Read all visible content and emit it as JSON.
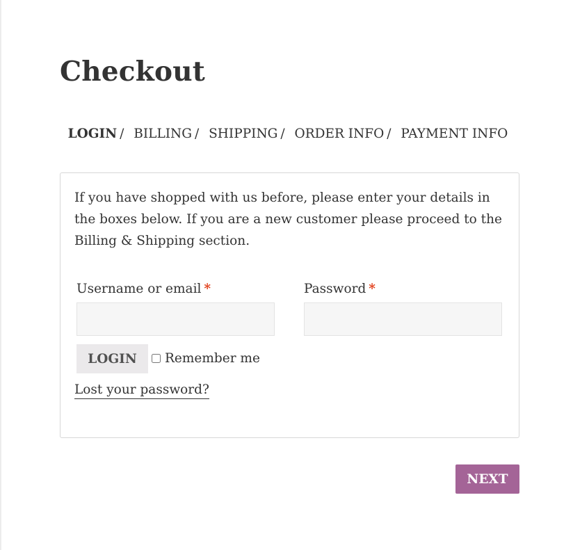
{
  "page": {
    "title": "Checkout"
  },
  "steps": [
    {
      "label": "LOGIN",
      "active": true
    },
    {
      "label": "BILLING",
      "active": false
    },
    {
      "label": "SHIPPING",
      "active": false
    },
    {
      "label": "ORDER INFO",
      "active": false
    },
    {
      "label": "PAYMENT INFO",
      "active": false
    }
  ],
  "step_separator": "/",
  "login_form": {
    "intro": "If you have shopped with us before, please enter your details in the boxes below. If you are a new customer please proceed to the Billing & Shipping section.",
    "username_label": "Username or email",
    "username_value": "",
    "password_label": "Password",
    "password_value": "",
    "required_marker": "*",
    "login_button": "LOGIN",
    "remember_label": "Remember me",
    "remember_checked": false,
    "lost_password": "Lost your password?"
  },
  "next_button": "NEXT",
  "colors": {
    "accent": "#a46497",
    "required": "#e2401c",
    "text": "#333333",
    "login_button_bg": "#ebe9eb"
  }
}
